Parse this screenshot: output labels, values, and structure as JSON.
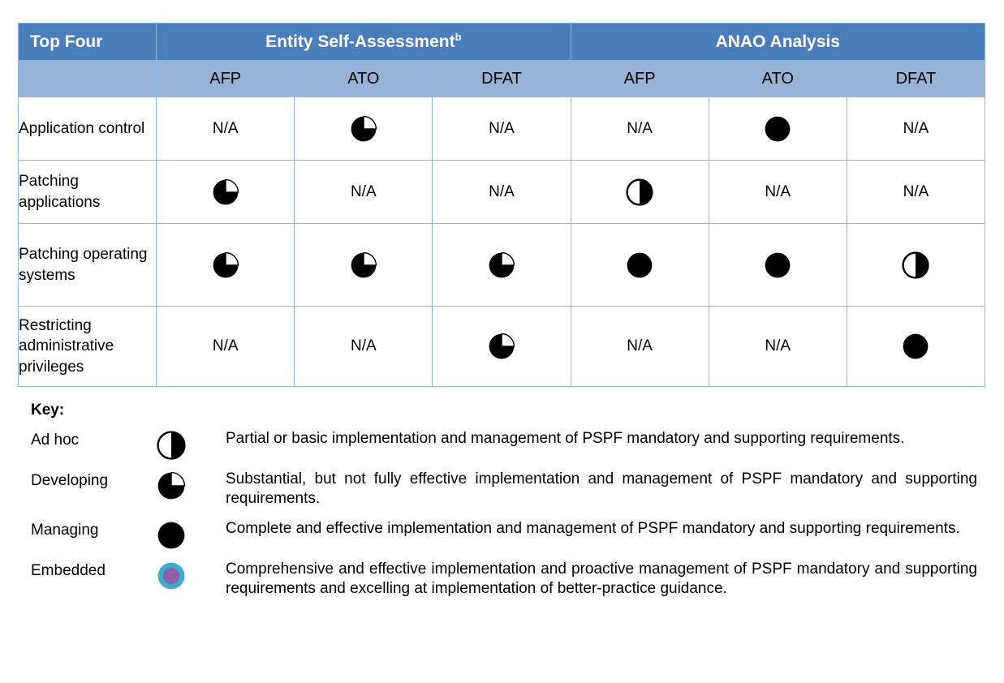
{
  "table": {
    "header_top": [
      {
        "label": "Top Four",
        "sup": "",
        "span": 1
      },
      {
        "label": "Entity Self-Assessment",
        "sup": "b",
        "span": 3
      },
      {
        "label": "ANAO Analysis",
        "sup": "",
        "span": 3
      }
    ],
    "header_sub": [
      "",
      "AFP",
      "ATO",
      "DFAT",
      "AFP",
      "ATO",
      "DFAT"
    ],
    "rows": [
      {
        "label": "Application control",
        "cells": [
          "N/A",
          "developing",
          "N/A",
          "N/A",
          "managing",
          "N/A"
        ]
      },
      {
        "label": "Patching applications",
        "cells": [
          "developing",
          "N/A",
          "N/A",
          "adhoc",
          "N/A",
          "N/A"
        ]
      },
      {
        "label": "Patching operating systems",
        "cells": [
          "developing",
          "developing",
          "developing",
          "managing",
          "managing",
          "adhoc"
        ]
      },
      {
        "label": "Restricting administrative privileges",
        "cells": [
          "N/A",
          "N/A",
          "developing",
          "N/A",
          "N/A",
          "managing"
        ]
      }
    ]
  },
  "key": {
    "title": "Key:",
    "entries": [
      {
        "term": "Ad hoc",
        "icon": "adhoc",
        "description": "Partial or basic implementation and management of PSPF mandatory and supporting requirements."
      },
      {
        "term": "Developing",
        "icon": "developing",
        "description": "Substantial, but not fully effective implementation and management of PSPF mandatory and supporting requirements."
      },
      {
        "term": "Managing",
        "icon": "managing",
        "description": "Complete and effective implementation and management of PSPF mandatory and supporting requirements."
      },
      {
        "term": "Embedded",
        "icon": "embedded",
        "description": "Comprehensive and effective implementation and proactive management of PSPF mandatory and supporting requirements and excelling at implementation of better-practice guidance."
      }
    ]
  },
  "colors": {
    "header_top_bg": "#4a7ebb",
    "header_sub_bg": "#95b3d7",
    "grid_line": "#8eb4e3",
    "icon_fill": "#000000",
    "embedded_inner": "#8b5fa8",
    "embedded_ring": "#3faccb"
  }
}
